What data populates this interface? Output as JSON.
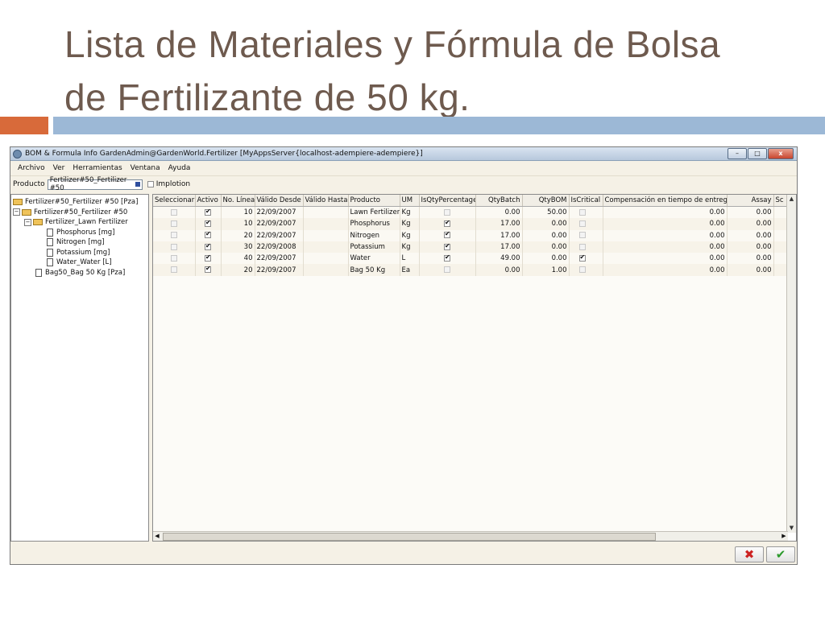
{
  "slide": {
    "title_line1": "Lista de Materiales y Fórmula de Bolsa",
    "title_line2": "de Fertilizante de 50 kg."
  },
  "window": {
    "title": "BOM & Formula Info  GardenAdmin@GardenWorld.Fertilizer [MyAppsServer{localhost-adempiere-adempiere}]",
    "buttons": {
      "minimize": "–",
      "maximize": "□",
      "close": "x"
    }
  },
  "menu": [
    "Archivo",
    "Ver",
    "Herramientas",
    "Ventana",
    "Ayuda"
  ],
  "params": {
    "product_label": "Producto",
    "product_value": "Fertilizer#50_Fertilizer #50",
    "implosion_label": "Implotion",
    "implosion_checked": false
  },
  "tree": [
    {
      "label": "Fertilizer#50_Fertilizer #50 [Pza]",
      "type": "folder"
    },
    {
      "label": "Fertilizer#50_Fertilizer #50",
      "type": "folder"
    },
    {
      "label": "Fertilizer_Lawn Fertilizer",
      "type": "folder"
    },
    {
      "label": "Phosphorus [mg]",
      "type": "doc"
    },
    {
      "label": "Nitrogen [mg]",
      "type": "doc"
    },
    {
      "label": "Potassium [mg]",
      "type": "doc"
    },
    {
      "label": "Water_Water [L]",
      "type": "doc"
    },
    {
      "label": "Bag50_Bag 50 Kg [Pza]",
      "type": "doc"
    }
  ],
  "table": {
    "columns": [
      "Seleccionar",
      "Activo",
      "No. Línea",
      "Válido Desde",
      "Válido Hasta",
      "Producto",
      "UM",
      "IsQtyPercentage",
      "QtyBatch",
      "QtyBOM",
      "IsCritical",
      "Compensación en tiempo de entrega",
      "Assay",
      "Sc"
    ],
    "rows": [
      {
        "seleccionar": false,
        "activo": true,
        "linea": "10",
        "desde": "22/09/2007",
        "hasta": "",
        "producto": "Lawn Fertilizer",
        "um": "Kg",
        "pct": false,
        "batch": "0.00",
        "bom": "50.00",
        "critical": false,
        "comp": "0.00",
        "assay": "0.00"
      },
      {
        "seleccionar": false,
        "activo": true,
        "linea": "10",
        "desde": "22/09/2007",
        "hasta": "",
        "producto": "Phosphorus",
        "um": "Kg",
        "pct": true,
        "batch": "17.00",
        "bom": "0.00",
        "critical": false,
        "comp": "0.00",
        "assay": "0.00"
      },
      {
        "seleccionar": false,
        "activo": true,
        "linea": "20",
        "desde": "22/09/2007",
        "hasta": "",
        "producto": "Nitrogen",
        "um": "Kg",
        "pct": true,
        "batch": "17.00",
        "bom": "0.00",
        "critical": false,
        "comp": "0.00",
        "assay": "0.00"
      },
      {
        "seleccionar": false,
        "activo": true,
        "linea": "30",
        "desde": "22/09/2008",
        "hasta": "",
        "producto": "Potassium",
        "um": "Kg",
        "pct": true,
        "batch": "17.00",
        "bom": "0.00",
        "critical": false,
        "comp": "0.00",
        "assay": "0.00"
      },
      {
        "seleccionar": false,
        "activo": true,
        "linea": "40",
        "desde": "22/09/2007",
        "hasta": "",
        "producto": "Water",
        "um": "L",
        "pct": true,
        "batch": "49.00",
        "bom": "0.00",
        "critical": true,
        "comp": "0.00",
        "assay": "0.00"
      },
      {
        "seleccionar": false,
        "activo": true,
        "linea": "20",
        "desde": "22/09/2007",
        "hasta": "",
        "producto": "Bag 50 Kg",
        "um": "Ea",
        "pct": false,
        "batch": "0.00",
        "bom": "1.00",
        "critical": false,
        "comp": "0.00",
        "assay": "0.00"
      }
    ]
  },
  "actions": {
    "cancel_icon": "✖",
    "ok_icon": "✔"
  }
}
